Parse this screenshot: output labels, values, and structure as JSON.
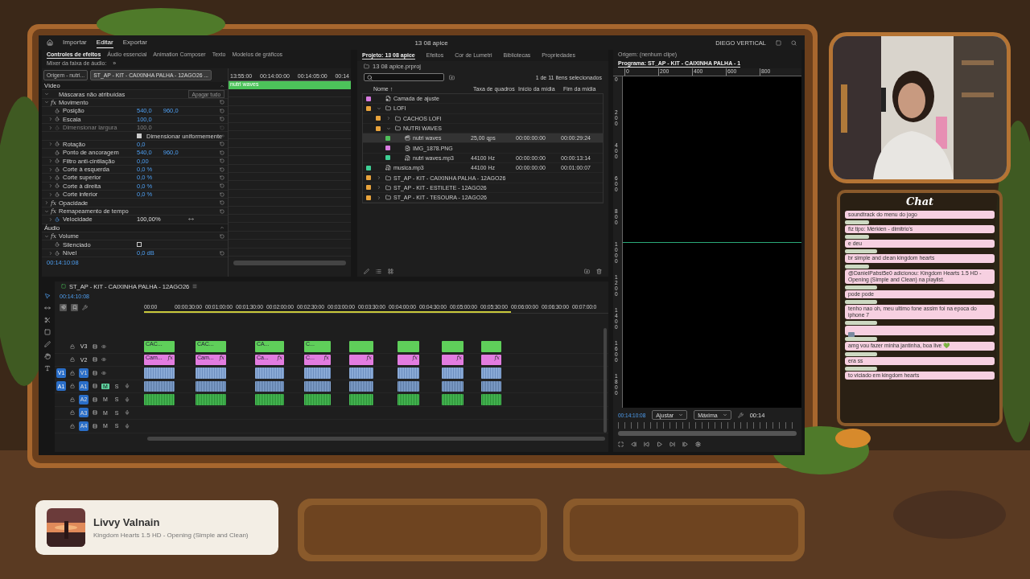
{
  "editor": {
    "menu": [
      {
        "label": "Importar",
        "selected": false
      },
      {
        "label": "Editar",
        "selected": true
      },
      {
        "label": "Exportar",
        "selected": false
      }
    ],
    "title": "13 08 apice",
    "workspace": "DIEGO VERTICAL",
    "effect_controls": {
      "tabs": [
        {
          "label": "Controles de efeitos",
          "selected": true
        },
        {
          "label": "Áudio essencial",
          "selected": false
        },
        {
          "label": "Animation Composer",
          "selected": false
        },
        {
          "label": "Texto",
          "selected": false
        },
        {
          "label": "Modelos de gráficos",
          "selected": false
        },
        {
          "label": "Mixer da faixa de áudio:",
          "selected": false
        }
      ],
      "more": "»",
      "source_tabs": [
        {
          "label": "Origem - nutri...",
          "selected": false
        },
        {
          "label": "ST_AP - KIT - CAIXINHA PALHA - 12AGO26 ...",
          "selected": true
        }
      ],
      "ruler": [
        "13:55:00",
        "00:14:00:00",
        "00:14:05:00",
        "00:14"
      ],
      "clip": "nutri waves",
      "rows": [
        {
          "kind": "section",
          "label": "Vídeo"
        },
        {
          "kind": "group",
          "label": "Máscaras não atribuídas",
          "expanded": true,
          "button": "Apagar tudo"
        },
        {
          "kind": "group",
          "label": "Movimento",
          "fx": "fx",
          "expanded": true
        },
        {
          "kind": "property",
          "label": "Posição",
          "values": [
            "540,0",
            "960,0"
          ]
        },
        {
          "kind": "property",
          "label": "Escala",
          "values": [
            "100,0"
          ],
          "expanded": false
        },
        {
          "kind": "property",
          "label": "Dimensionar largura",
          "values": [
            "100,0"
          ],
          "expanded": false,
          "disabled": true
        },
        {
          "kind": "checkbox",
          "label": "Dimensionar uniformemente",
          "checked": true
        },
        {
          "kind": "property",
          "label": "Rotação",
          "values": [
            "0,0"
          ],
          "expanded": false
        },
        {
          "kind": "property",
          "label": "Ponto de ancoragem",
          "values": [
            "540,0",
            "960,0"
          ]
        },
        {
          "kind": "property",
          "label": "Filtro anti-cintilação",
          "values": [
            "0,00"
          ],
          "expanded": false
        },
        {
          "kind": "property",
          "label": "Corte à esquerda",
          "values": [
            "0,0 %"
          ],
          "expanded": false
        },
        {
          "kind": "property",
          "label": "Corte superior",
          "values": [
            "0,0 %"
          ],
          "expanded": false
        },
        {
          "kind": "property",
          "label": "Corte à direita",
          "values": [
            "0,0 %"
          ],
          "expanded": false
        },
        {
          "kind": "property",
          "label": "Corte inferior",
          "values": [
            "0,0 %"
          ],
          "expanded": false
        },
        {
          "kind": "group",
          "label": "Opacidade",
          "fx": "fx",
          "expanded": false
        },
        {
          "kind": "group",
          "label": "Remapeamento de tempo",
          "fx": "fx",
          "expanded": true
        },
        {
          "kind": "property",
          "label": "Velocidade",
          "values": [
            "100,00%"
          ],
          "expanded": false,
          "animated": true,
          "keyframes": true
        },
        {
          "kind": "section",
          "label": "Áudio"
        },
        {
          "kind": "group",
          "label": "Volume",
          "fx": "fx",
          "expanded": true
        },
        {
          "kind": "toggle",
          "label": "Silenciado",
          "checked": false
        },
        {
          "kind": "property",
          "label": "Nível",
          "values": [
            "0,0 dB"
          ],
          "expanded": false
        }
      ],
      "timecode": "00:14:10:08"
    },
    "project": {
      "tabs": [
        {
          "label": "Projeto: 13 08 apice",
          "selected": true
        },
        {
          "label": "Efeitos",
          "selected": false
        },
        {
          "label": "Cor de Lumetri",
          "selected": false
        },
        {
          "label": "Bibliotecas",
          "selected": false
        },
        {
          "label": "Propriedades",
          "selected": false
        }
      ],
      "file": "13 08 apice.prproj",
      "count": "1 de 11 itens selecionados",
      "sort_mark": "↑",
      "columns": [
        "Nome",
        "Taxa de quadros",
        "Início da mídia",
        "Fim da mídia"
      ],
      "rows": [
        {
          "name": "Camada de ajuste",
          "kind": "adjust",
          "color": "#d77be0",
          "selected": false
        },
        {
          "name": "LOFI",
          "kind": "folder",
          "color": "#e8a33c",
          "expanded": true,
          "selected": false,
          "children": [
            {
              "name": "CACHOS LOFI",
              "kind": "folder",
              "color": "#e8a33c",
              "expanded": false,
              "selected": false
            },
            {
              "name": "NUTRI WAVES",
              "kind": "folder",
              "color": "#e8a33c",
              "expanded": true,
              "selected": false,
              "children": [
                {
                  "name": "nutri waves",
                  "kind": "sequence",
                  "color": "#4fbf5a",
                  "selected": true,
                  "rate": "25,00 qps",
                  "start": "00:00:00:00",
                  "end": "00:00:29:24"
                },
                {
                  "name": "IMG_1878.PNG",
                  "color": "#d77be0",
                  "selected": false
                },
                {
                  "name": "nutri waves.mp3",
                  "kind": "audio",
                  "color": "#3ecf95",
                  "selected": false,
                  "rate": "44100 Hz",
                  "start": "00:00:00:00",
                  "end": "00:00:13:14"
                }
              ]
            }
          ]
        },
        {
          "name": "musica.mp3",
          "kind": "audio",
          "color": "#3ecf95",
          "selected": false,
          "rate": "44100 Hz",
          "start": "00:00:00:00",
          "end": "00:01:00:07"
        },
        {
          "name": "ST_AP - KIT - CAIXINHA PALHA  - 12AGO26",
          "kind": "folder",
          "color": "#e8a33c",
          "expanded": false,
          "selected": false
        },
        {
          "name": "ST_AP - KIT - ESTILETE  - 12AGO26",
          "kind": "folder",
          "color": "#e8a33c",
          "expanded": false,
          "selected": false
        },
        {
          "name": "ST_AP - KIT - TESOURA  - 12AGO26",
          "kind": "folder",
          "color": "#e8a33c",
          "expanded": false,
          "selected": false
        }
      ]
    },
    "monitor": {
      "tabs": [
        {
          "label": "Origem: (nenhum clipe)",
          "selected": false
        },
        {
          "label": "Programa: ST_AP - KIT - CAIXINHA PALHA - 1",
          "selected": true
        }
      ],
      "ruler": [
        "0",
        "200",
        "400",
        "600",
        "800"
      ],
      "vertical_ruler": [
        "0",
        "200",
        "400",
        "600",
        "800",
        "1000",
        "1200",
        "1400",
        "1600",
        "1800"
      ],
      "timecode": "00:14:10:08",
      "fit": "Ajustar",
      "quality": "Máxima",
      "duration": "00:14"
    },
    "timeline": {
      "sequence": "ST_AP - KIT - CAIXINHA PALHA  - 12AGO26",
      "timecode": "00:14:10:08",
      "ruler": [
        "00:00",
        "00:00:30:00",
        "00:01:00:00",
        "00:01:30:00",
        "00:02:00:00",
        "00:02:30:00",
        "00:03:00:00",
        "00:03:30:00",
        "00:04:00:00",
        "00:04:30:00",
        "00:05:00:00",
        "00:05:30:00",
        "00:06:00:00",
        "00:06:30:00",
        "00:07:00:0"
      ],
      "tracks": [
        {
          "label": "V3",
          "kind": "video",
          "clip": {
            "kind": "title"
          },
          "targeted": false
        },
        {
          "label": "V2",
          "kind": "video",
          "clip": {
            "kind": "graphic"
          },
          "targeted": false
        },
        {
          "label": "V1",
          "kind": "video",
          "clip": {
            "kind": "video"
          },
          "targeted": true,
          "patch": "V1"
        },
        {
          "label": "A1",
          "kind": "audio",
          "clip": {
            "kind": "audio"
          },
          "targeted": true,
          "patch": "A1",
          "mute": "M",
          "solo": "S",
          "muted": true
        },
        {
          "label": "A2",
          "kind": "audio",
          "clip": {
            "kind": "music"
          },
          "targeted": true,
          "mute": "M",
          "solo": "S",
          "muted": false
        },
        {
          "label": "A3",
          "kind": "audio",
          "targeted": true,
          "mute": "M",
          "solo": "S",
          "muted": false
        },
        {
          "label": "A4",
          "kind": "audio",
          "targeted": true,
          "mute": "M",
          "solo": "S",
          "muted": false
        }
      ],
      "clips": [
        {
          "title": "CAC...",
          "graphic": "Cam...",
          "fx": "fx"
        },
        {
          "title": "CAC...",
          "graphic": "Cam...",
          "fx": "fx"
        },
        {
          "title": "CA...",
          "graphic": "Ca...",
          "fx": "fx"
        },
        {
          "title": "C...",
          "graphic": "C...",
          "fx": "fx"
        },
        {
          "fx": "fx"
        },
        {
          "fx": "fx"
        },
        {
          "fx": "fx"
        },
        {
          "fx": "fx"
        }
      ]
    }
  },
  "chat": {
    "title": "Chat",
    "messages": [
      {
        "kind": "text",
        "text": "soundtrack do menu do jogo"
      },
      {
        "kind": "text",
        "text": "fiz tipo: Mérkien - dimitrio's"
      },
      {
        "kind": "text",
        "text": "e deu"
      },
      {
        "kind": "text",
        "text": "br simple and clean kingdom hearts"
      },
      {
        "kind": "text",
        "text": "@DanielPabst5e0 adicionou: Kingdom Hearts 1.5 HD - Opening (Simple and Clean) na playlist."
      },
      {
        "kind": "text",
        "text": "pode pode"
      },
      {
        "kind": "text",
        "text": "tenho nao oh, meu ultimo fone assim foi na epoca do iphone 7"
      },
      {
        "kind": "sticker"
      },
      {
        "kind": "text",
        "text": "amg vou fazer minha jantinha, boa live 💚"
      },
      {
        "kind": "text",
        "text": "era ss"
      },
      {
        "kind": "text",
        "text": "to viciado em kingdom hearts"
      }
    ]
  },
  "now_playing": {
    "artist": "Livvy Valnain",
    "song": "Kingdom Hearts 1.5 HD - Opening (Simple and Clean)"
  }
}
